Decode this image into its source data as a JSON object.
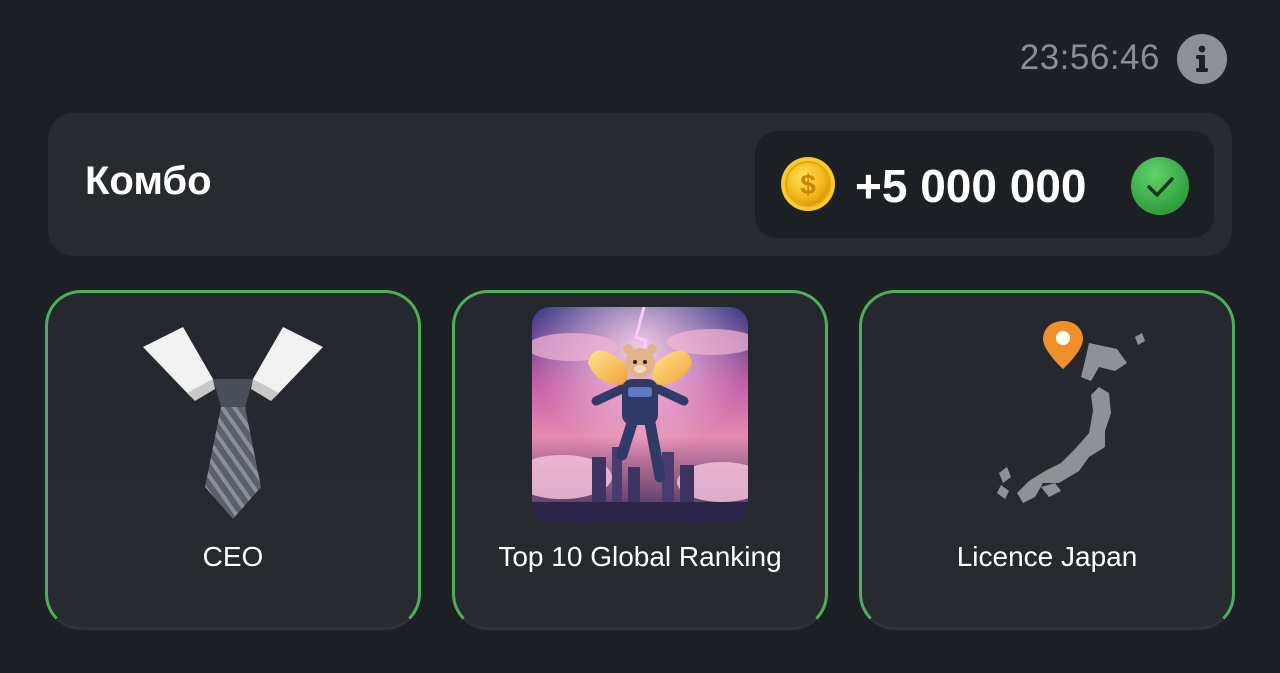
{
  "header": {
    "timer": "23:56:46",
    "info_icon": "info-icon"
  },
  "combo": {
    "title": "Комбо",
    "reward_icon": "coin-icon",
    "reward_amount": "+5 000 000",
    "status_icon": "checkmark-icon"
  },
  "cards": [
    {
      "label": "CEO",
      "icon": "necktie-icon"
    },
    {
      "label": "Top 10 Global Ranking",
      "icon": "hamster-astronaut-image"
    },
    {
      "label": "Licence Japan",
      "icon": "japan-map-icon"
    }
  ],
  "colors": {
    "background": "#1c1f24",
    "panel": "#272a2f",
    "card_border": "#4fae5c",
    "coin_gold": "#f3c21f",
    "check_green": "#3fae4b",
    "location_pin": "#f0902a"
  }
}
